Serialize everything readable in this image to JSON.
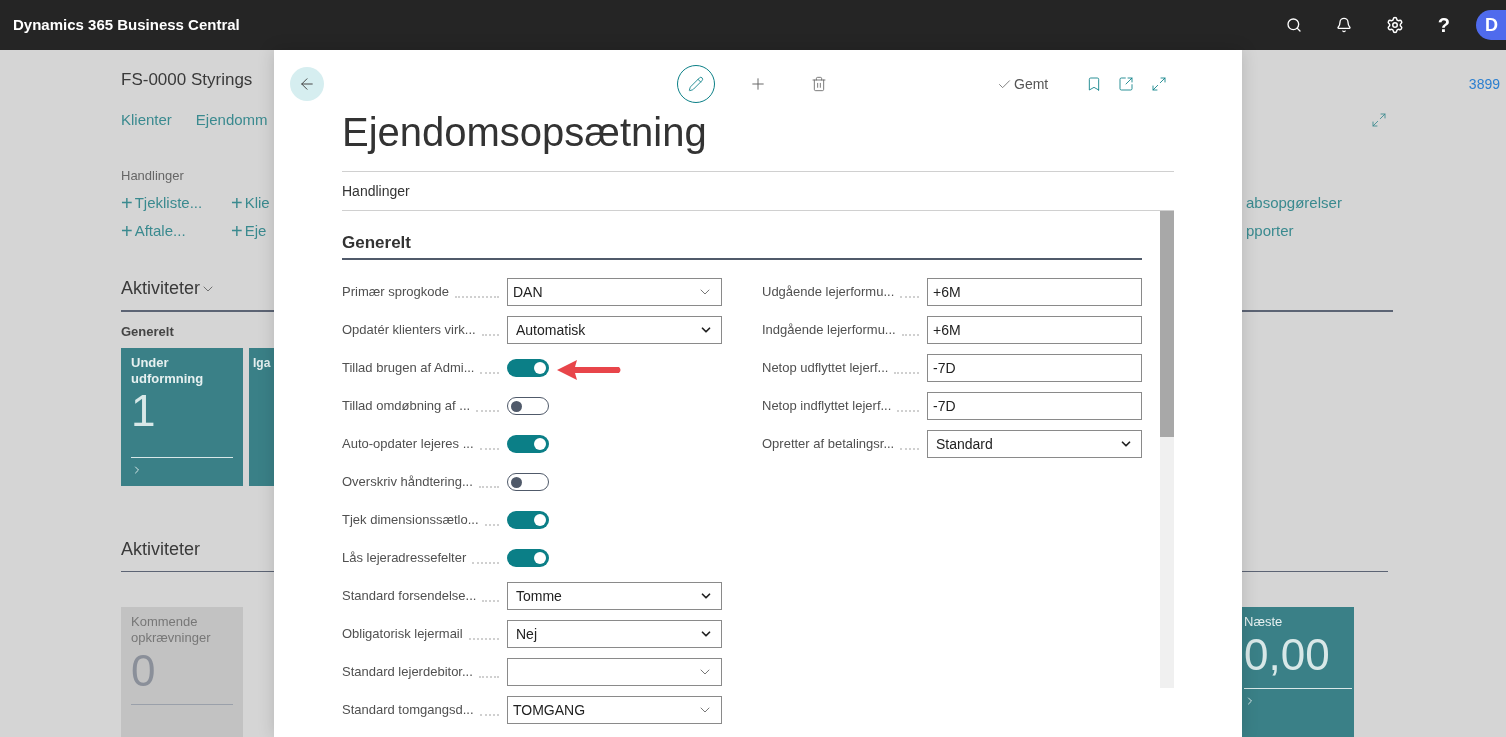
{
  "top_bar": {
    "app_name": "Dynamics 365 Business Central",
    "help": "?",
    "avatar": "D"
  },
  "background_page": {
    "title": "FS-0000 Styrings",
    "record_no": "3899",
    "nav": [
      "Klienter",
      "Ejendomm"
    ],
    "actions_label": "Handlinger",
    "actions": [
      {
        "icon": "+",
        "label": "Tjekliste..."
      },
      {
        "icon": "+",
        "label": "Klie"
      },
      {
        "icon": "+",
        "label": "Aftale..."
      },
      {
        "icon": "+",
        "label": "Eje"
      }
    ],
    "right_links": [
      "absopgørelser",
      "pporter"
    ],
    "activities_heading": "Aktiviteter",
    "group_label": "Generelt",
    "tiles": [
      {
        "title": "Under udformning",
        "value": "1"
      },
      {
        "title": "Iga"
      }
    ],
    "activities_heading_2": "Aktiviteter",
    "tiles_2": [
      {
        "title": "Kommende opkrævninger",
        "value": "0",
        "kind": "gray"
      },
      {
        "title": "Næste",
        "value": "0,00",
        "kind": "teal"
      }
    ]
  },
  "dialog": {
    "saved": "Gemt",
    "title": "Ejendomsopsætning",
    "menu": "Handlinger",
    "section": "Generelt",
    "left_fields": [
      {
        "label": "Primær sprogkode",
        "kind": "lookup",
        "value": "DAN"
      },
      {
        "label": "Opdatér klienters virk...",
        "kind": "select",
        "value": "Automatisk"
      },
      {
        "label": "Tillad brugen af Admi...",
        "kind": "toggle",
        "on": true
      },
      {
        "label": "Tillad omdøbning af ...",
        "kind": "toggle",
        "on": false
      },
      {
        "label": "Auto-opdater lejeres ...",
        "kind": "toggle",
        "on": true
      },
      {
        "label": "Overskriv håndtering...",
        "kind": "toggle",
        "on": false
      },
      {
        "label": "Tjek dimensionssætlo...",
        "kind": "toggle",
        "on": true
      },
      {
        "label": "Lås lejeradressefelter",
        "kind": "toggle",
        "on": true
      },
      {
        "label": "Standard forsendelse...",
        "kind": "select",
        "value": "Tomme"
      },
      {
        "label": "Obligatorisk lejermail",
        "kind": "select",
        "value": "Nej"
      },
      {
        "label": "Standard lejerdebitor...",
        "kind": "lookup"
      },
      {
        "label": "Standard tomgangsd...",
        "kind": "lookup",
        "value": "TOMGANG"
      }
    ],
    "right_fields": [
      {
        "label": "Udgående lejerformu...",
        "kind": "text",
        "value": "+6M"
      },
      {
        "label": "Indgående lejerformu...",
        "kind": "text",
        "value": "+6M"
      },
      {
        "label": "Netop udflyttet lejerf...",
        "kind": "text",
        "value": "-7D"
      },
      {
        "label": "Netop indflyttet lejerf...",
        "kind": "text",
        "value": "-7D"
      },
      {
        "label": "Opretter af betalingsr...",
        "kind": "select",
        "value": "Standard"
      }
    ]
  }
}
